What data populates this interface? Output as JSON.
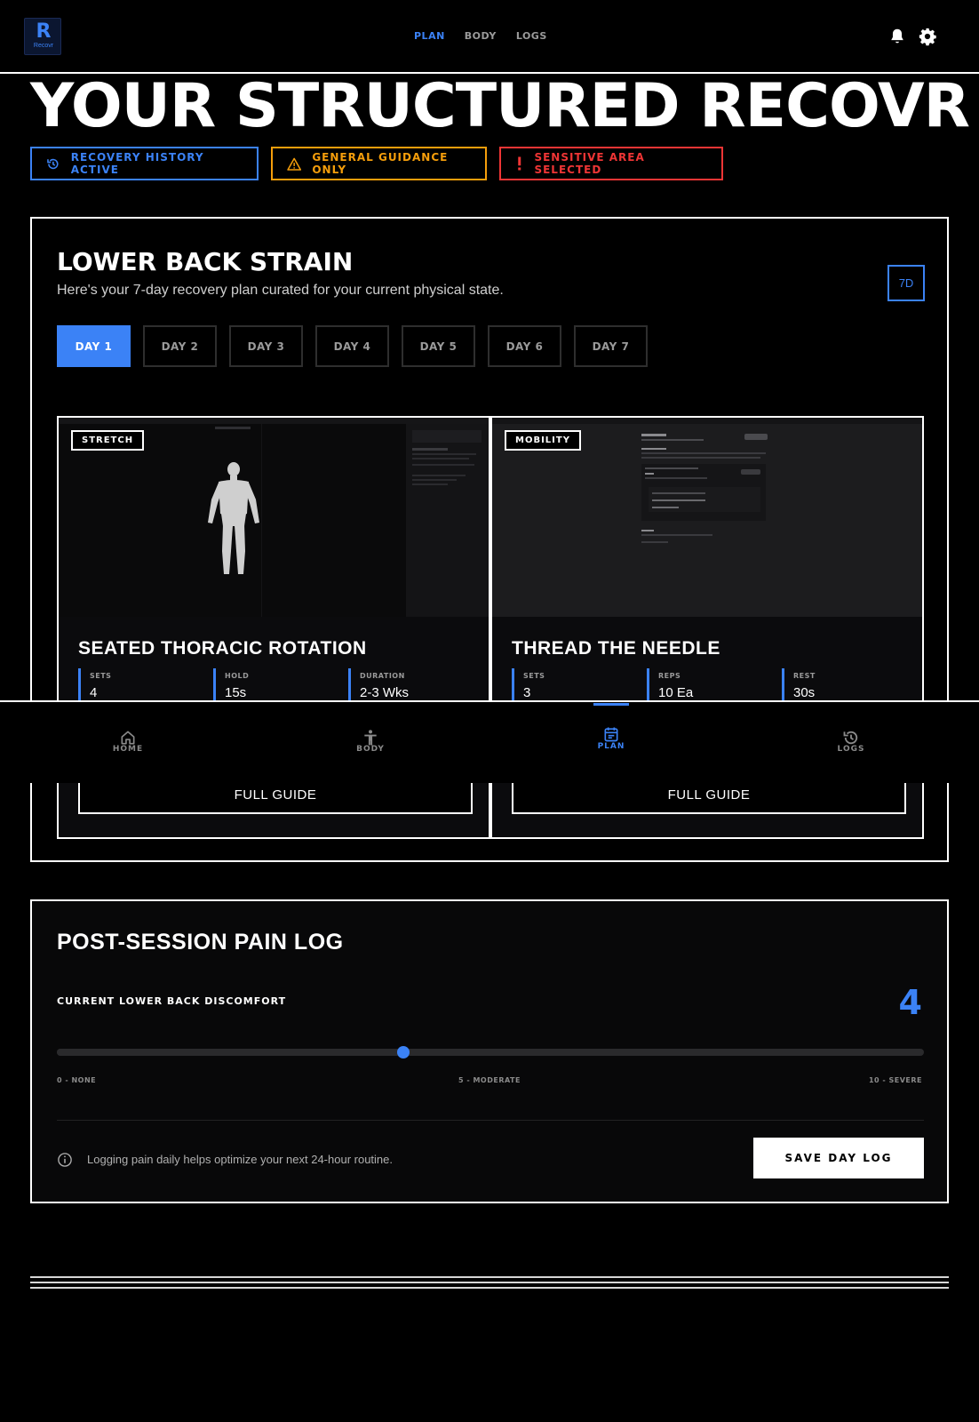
{
  "app": {
    "logo_glyph": "R",
    "logo_word": "Recovr"
  },
  "topnav": {
    "links": [
      {
        "label": "PLAN",
        "active": true
      },
      {
        "label": "BODY",
        "active": false
      },
      {
        "label": "LOGS",
        "active": false
      }
    ]
  },
  "hero": {
    "title": "YOUR STRUCTURED RECOVR"
  },
  "badges": {
    "history": "RECOVERY HISTORY ACTIVE",
    "guidance": "GENERAL GUIDANCE ONLY",
    "sensitive": "SENSITIVE AREA SELECTED"
  },
  "plan": {
    "title": "LOWER BACK STRAIN",
    "subtitle": "Here's your 7-day recovery plan curated for your current physical state.",
    "duration_chip": "7D",
    "days": [
      "DAY 1",
      "DAY 2",
      "DAY 3",
      "DAY 4",
      "DAY 5",
      "DAY 6",
      "DAY 7"
    ],
    "active_day": 0
  },
  "exercises": [
    {
      "tag": "STRETCH",
      "name": "SEATED THORACIC ROTATION",
      "stats": [
        {
          "label": "SETS",
          "value": "4"
        },
        {
          "label": "HOLD",
          "value": "15s"
        },
        {
          "label": "DURATION",
          "value": "2-3 Wks"
        }
      ],
      "cta": "FULL GUIDE"
    },
    {
      "tag": "MOBILITY",
      "name": "THREAD THE NEEDLE",
      "stats": [
        {
          "label": "SETS",
          "value": "3"
        },
        {
          "label": "REPS",
          "value": "10 Ea"
        },
        {
          "label": "REST",
          "value": "30s"
        }
      ],
      "cta": "FULL GUIDE"
    }
  ],
  "tabbar": {
    "tabs": [
      {
        "label": "HOME",
        "icon": "home-icon",
        "active": false
      },
      {
        "label": "BODY",
        "icon": "body-icon",
        "active": false
      },
      {
        "label": "PLAN",
        "icon": "calendar-icon",
        "active": true
      },
      {
        "label": "LOGS",
        "icon": "history-icon",
        "active": false
      }
    ]
  },
  "pain_log": {
    "title": "POST-SESSION PAIN LOG",
    "label": "CURRENT LOWER BACK DISCOMFORT",
    "value": 4,
    "value_text": "4",
    "min": 0,
    "max": 10,
    "scale_min": "0 - NONE",
    "scale_mid": "5 - MODERATE",
    "scale_max": "10 - SEVERE",
    "hint": "Logging pain daily helps optimize your next 24-hour routine.",
    "save_label": "SAVE DAY LOG"
  },
  "colors": {
    "accent": "#3b82f6",
    "warning": "#f59e0b",
    "danger": "#ef3535",
    "background": "#000000"
  }
}
